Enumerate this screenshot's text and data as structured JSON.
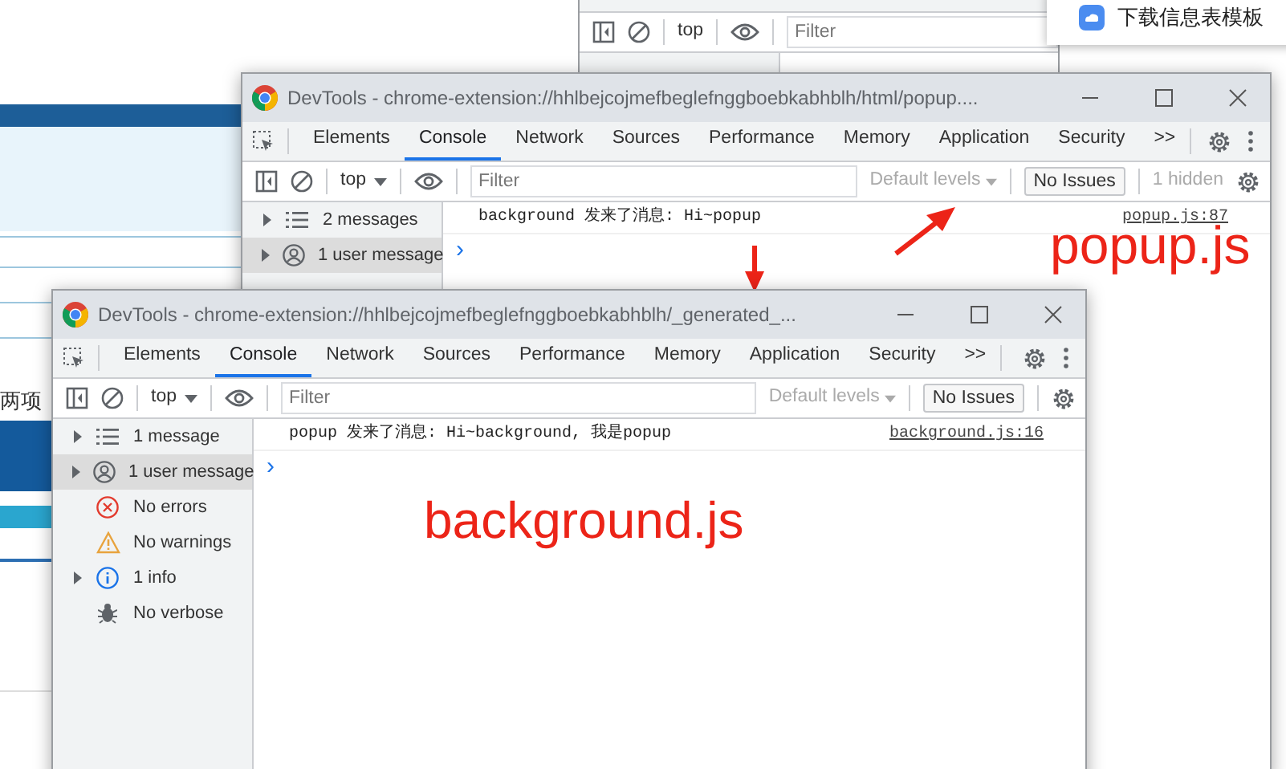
{
  "background_page": {
    "text": "两项"
  },
  "back_window": {
    "context": "top",
    "filter_placeholder": "Filter"
  },
  "notification": {
    "text": "下载信息表模板"
  },
  "windows": [
    {
      "title": "DevTools - chrome-extension://hhlbejcojmefbeglefnggboebkabhblh/html/popup....",
      "tabs": [
        {
          "label": "Elements",
          "selected": false
        },
        {
          "label": "Console",
          "selected": true
        },
        {
          "label": "Network",
          "selected": false
        },
        {
          "label": "Sources",
          "selected": false
        },
        {
          "label": "Performance",
          "selected": false
        },
        {
          "label": "Memory",
          "selected": false
        },
        {
          "label": "Application",
          "selected": false
        },
        {
          "label": "Security",
          "selected": false
        },
        {
          "label": ">>",
          "selected": false
        }
      ],
      "context": "top",
      "filter_placeholder": "Filter",
      "levels": "Default levels",
      "issues": "No Issues",
      "hidden": "1 hidden",
      "sidebar": [
        {
          "kind": "messages",
          "label": "2 messages",
          "expandable": true,
          "selected": false
        },
        {
          "kind": "user",
          "label": "1 user message",
          "expandable": true,
          "selected": true
        }
      ],
      "messages": [
        {
          "text": "background 发来了消息: Hi~popup",
          "source": "popup.js:87"
        }
      ],
      "prompt": "›"
    },
    {
      "title": "DevTools - chrome-extension://hhlbejcojmefbeglefnggboebkabhblh/_generated_...",
      "tabs": [
        {
          "label": "Elements",
          "selected": false
        },
        {
          "label": "Console",
          "selected": true
        },
        {
          "label": "Network",
          "selected": false
        },
        {
          "label": "Sources",
          "selected": false
        },
        {
          "label": "Performance",
          "selected": false
        },
        {
          "label": "Memory",
          "selected": false
        },
        {
          "label": "Application",
          "selected": false
        },
        {
          "label": "Security",
          "selected": false
        },
        {
          "label": ">>",
          "selected": false
        }
      ],
      "context": "top",
      "filter_placeholder": "Filter",
      "levels": "Default levels",
      "issues": "No Issues",
      "sidebar": [
        {
          "kind": "messages",
          "label": "1 message",
          "expandable": true,
          "selected": false
        },
        {
          "kind": "user",
          "label": "1 user message",
          "expandable": true,
          "selected": true
        },
        {
          "kind": "errors",
          "label": "No errors",
          "expandable": false,
          "selected": false
        },
        {
          "kind": "warnings",
          "label": "No warnings",
          "expandable": false,
          "selected": false
        },
        {
          "kind": "info",
          "label": "1 info",
          "expandable": true,
          "selected": false
        },
        {
          "kind": "verbose",
          "label": "No verbose",
          "expandable": false,
          "selected": false
        }
      ],
      "messages": [
        {
          "text": "popup 发来了消息: Hi~background, 我是popup",
          "source": "background.js:16"
        }
      ],
      "prompt": "›"
    }
  ],
  "annotations": [
    {
      "text": "popup.js"
    },
    {
      "text": "background.js"
    }
  ]
}
